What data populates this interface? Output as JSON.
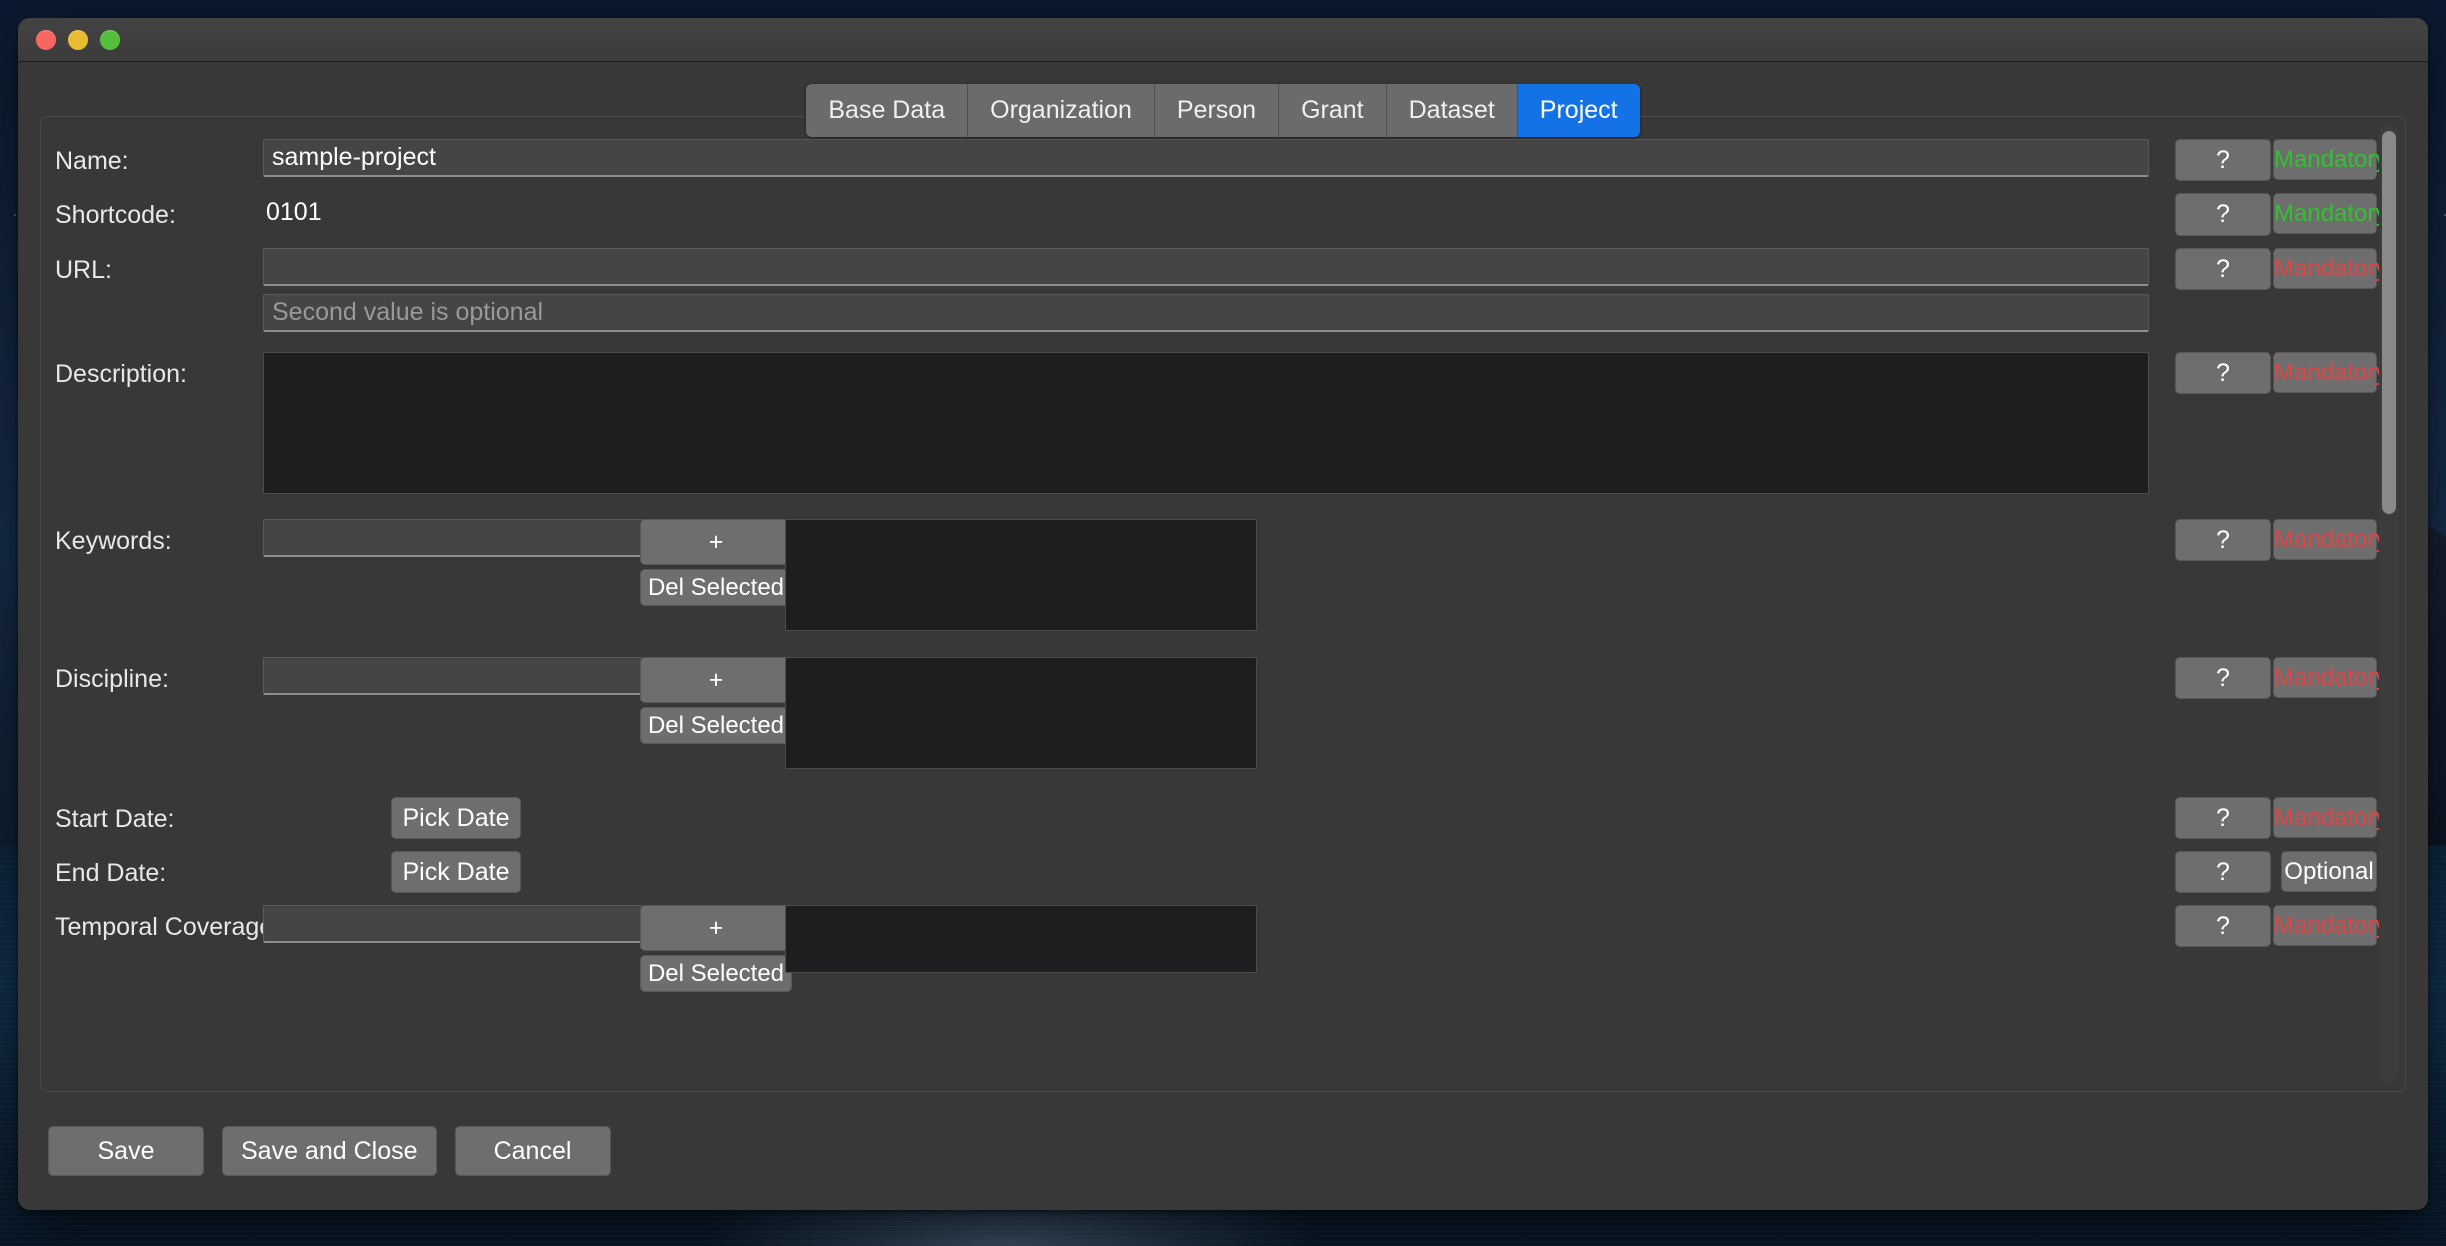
{
  "window": {
    "traffic_lights": [
      "close",
      "minimize",
      "zoom"
    ],
    "accent_color": "#1373e6",
    "flag_ok_color": "#2fc32f",
    "flag_required_color": "#e04545"
  },
  "tabs": [
    {
      "label": "Base Data",
      "active": false
    },
    {
      "label": "Organization",
      "active": false
    },
    {
      "label": "Person",
      "active": false
    },
    {
      "label": "Grant",
      "active": false
    },
    {
      "label": "Dataset",
      "active": false
    },
    {
      "label": "Project",
      "active": true
    }
  ],
  "form": {
    "name": {
      "label": "Name:",
      "value": "sample-project",
      "placeholder": "",
      "help": "?",
      "flag": "Mandatory",
      "flag_state": "ok"
    },
    "shortcode": {
      "label": "Shortcode:",
      "value": "0101",
      "help": "?",
      "flag": "Mandatory",
      "flag_state": "ok"
    },
    "url": {
      "label": "URL:",
      "value": "",
      "placeholder": "",
      "second_value": "",
      "second_placeholder": "Second value is optional",
      "help": "?",
      "flag": "Mandatory",
      "flag_state": "required"
    },
    "description": {
      "label": "Description:",
      "value": "",
      "help": "?",
      "flag": "Mandatory",
      "flag_state": "required"
    },
    "keywords": {
      "label": "Keywords:",
      "value": "",
      "placeholder": "",
      "add_label": "+",
      "delete_label": "Del Selected",
      "items": [],
      "help": "?",
      "flag": "Mandatory",
      "flag_state": "required"
    },
    "discipline": {
      "label": "Discipline:",
      "value": "",
      "placeholder": "",
      "add_label": "+",
      "delete_label": "Del Selected",
      "items": [],
      "help": "?",
      "flag": "Mandatory",
      "flag_state": "required"
    },
    "start_date": {
      "label": "Start Date:",
      "pick_label": "Pick Date",
      "value": "",
      "help": "?",
      "flag": "Mandatory",
      "flag_state": "required"
    },
    "end_date": {
      "label": "End Date:",
      "pick_label": "Pick Date",
      "value": "",
      "help": "?",
      "flag": "Optional",
      "flag_state": "optional"
    },
    "temporal_coverage": {
      "label": "Temporal Coverage:",
      "value": "",
      "placeholder": "",
      "add_label": "+",
      "delete_label": "Del Selected",
      "items": [],
      "help": "?",
      "flag": "Mandatory",
      "flag_state": "required"
    }
  },
  "footer": {
    "save": "Save",
    "save_and_close": "Save and Close",
    "cancel": "Cancel"
  },
  "scrollbar": {
    "thumb_position_percent": 0,
    "thumb_size_percent": 40
  }
}
